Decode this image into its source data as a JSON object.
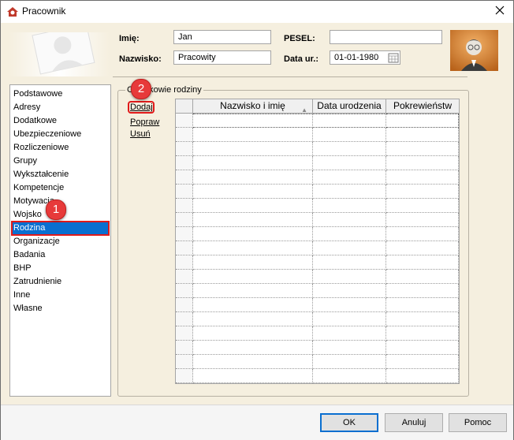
{
  "window": {
    "title": "Pracownik"
  },
  "header": {
    "first_name_label": "Imię:",
    "first_name_value": "Jan",
    "last_name_label": "Nazwisko:",
    "last_name_value": "Pracowity",
    "pesel_label": "PESEL:",
    "pesel_value": "",
    "birth_date_label": "Data ur.:",
    "birth_date_value": "01-01-1980"
  },
  "sidebar": {
    "items": [
      {
        "label": "Podstawowe"
      },
      {
        "label": "Adresy"
      },
      {
        "label": "Dodatkowe"
      },
      {
        "label": "Ubezpieczeniowe"
      },
      {
        "label": "Rozliczeniowe"
      },
      {
        "label": "Grupy"
      },
      {
        "label": "Wykształcenie"
      },
      {
        "label": "Kompetencje"
      },
      {
        "label": "Motywacja"
      },
      {
        "label": "Wojsko"
      },
      {
        "label": "Rodzina"
      },
      {
        "label": "Organizacje"
      },
      {
        "label": "Badania"
      },
      {
        "label": "BHP"
      },
      {
        "label": "Zatrudnienie"
      },
      {
        "label": "Inne"
      },
      {
        "label": "Własne"
      }
    ],
    "selected": "Rodzina"
  },
  "family_group": {
    "label": "Członkowie rodziny",
    "add_label": "Dodaj",
    "edit_label": "Popraw",
    "delete_label": "Usuń"
  },
  "grid": {
    "columns": [
      "",
      "Nazwisko i imię",
      "Data urodzenia",
      "Pokrewieństw"
    ],
    "row_count": 19
  },
  "badges": {
    "first": "1",
    "second": "2"
  },
  "buttons": {
    "ok": "OK",
    "cancel": "Anuluj",
    "help": "Pomoc"
  },
  "colors": {
    "selected": "#0a6fd0",
    "highlight": "#e01a1a",
    "panel": "#f5efdf"
  }
}
